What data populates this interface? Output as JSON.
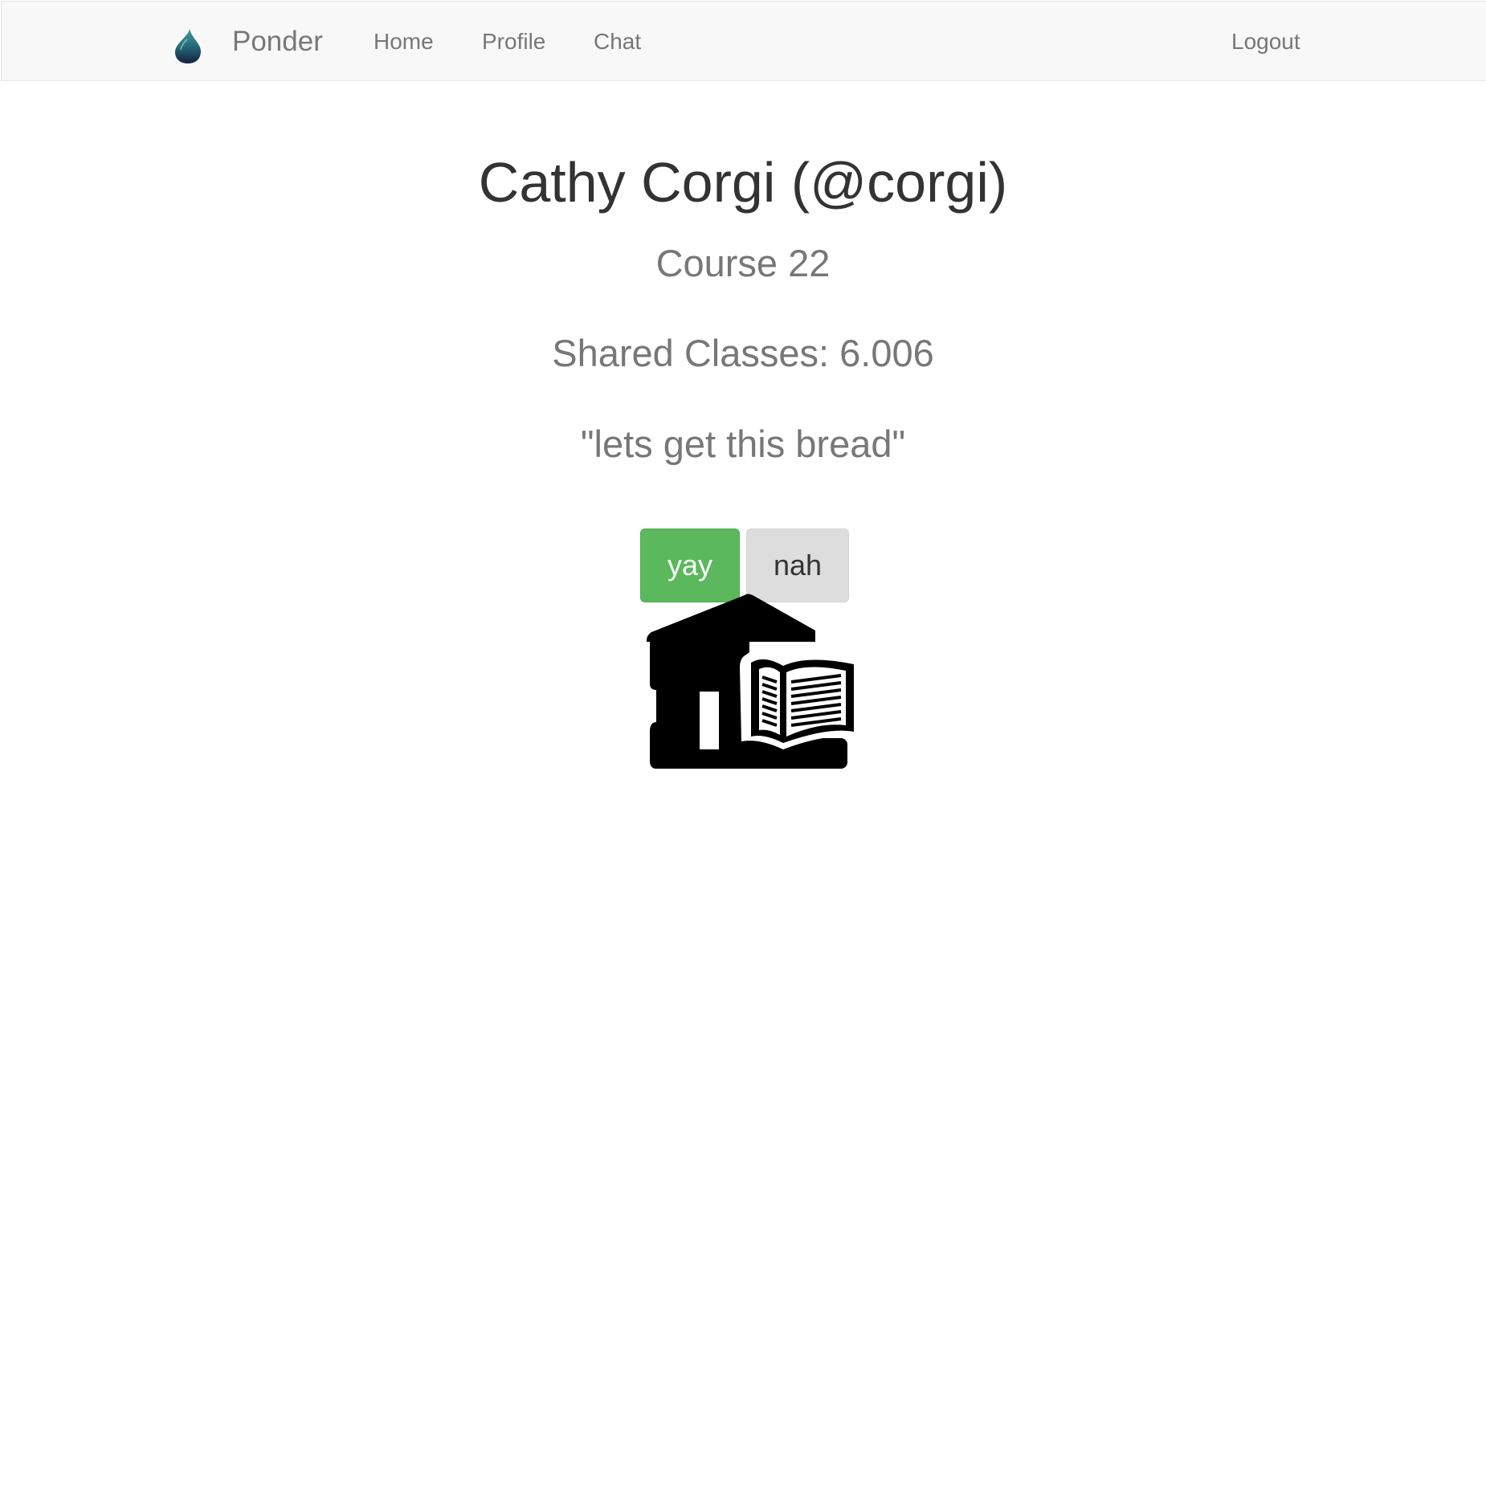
{
  "navbar": {
    "brand_name": "Ponder",
    "brand_icon": "water-drop-icon",
    "links": {
      "home": "Home",
      "profile": "Profile",
      "chat": "Chat",
      "logout": "Logout"
    }
  },
  "profile": {
    "name": "Cathy Corgi (@corgi)",
    "course": "Course 22",
    "shared_classes": "Shared Classes: 6.006",
    "quote": "\"lets get this bread\""
  },
  "actions": {
    "yay_label": "yay",
    "nah_label": "nah"
  },
  "image": {
    "icon": "school-building-book-icon"
  },
  "colors": {
    "yay_button": "#5cb85c",
    "nah_button": "#dddddd",
    "navbar_bg": "#f8f8f8",
    "drop_top": "#2a8a8a",
    "drop_bottom": "#1a2a4a"
  }
}
